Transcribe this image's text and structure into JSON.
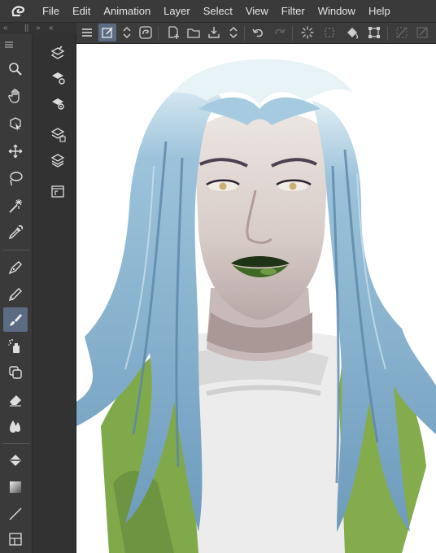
{
  "menu": {
    "items": [
      "File",
      "Edit",
      "Animation",
      "Layer",
      "Select",
      "View",
      "Filter",
      "Window",
      "Help"
    ]
  },
  "panel_tabs": {
    "left": "«",
    "grip": "||",
    "right": "»",
    "left2": "«"
  },
  "command_bar": {
    "icons": [
      "menu-icon",
      "canvas-edit-icon",
      "chevron-updown-icon",
      "clip-studio-icon",
      "new-file-icon",
      "open-file-icon",
      "save-icon",
      "chevron-updown-icon",
      "undo-icon",
      "redo-icon",
      "loading-spinner-icon",
      "deselect-icon",
      "fill-icon",
      "transform-icon",
      "hide-selection-icon",
      "edit-selection-icon"
    ]
  },
  "tools": [
    "zoom-icon",
    "hand-icon",
    "operation-icon",
    "move-layer-icon",
    "lasso-icon",
    "magic-wand-icon",
    "eyedropper-icon",
    "pen-icon",
    "pencil-icon",
    "brush-icon",
    "airbrush-icon",
    "decoration-icon",
    "eraser-icon",
    "blend-icon",
    "fill-icon",
    "gradient-icon",
    "line-icon",
    "frame-icon"
  ],
  "active_tool": "brush-icon",
  "subtools": [
    "layer-property-icon",
    "layer-settings-icon",
    "layer-search-icon",
    "layer-palette-icon",
    "layers-icon",
    "material-icon"
  ],
  "colors": {
    "accent": "#5a6b82",
    "hair": "#7fa9c8",
    "jacket": "#7fa648",
    "lips": "#2e4a1e"
  }
}
